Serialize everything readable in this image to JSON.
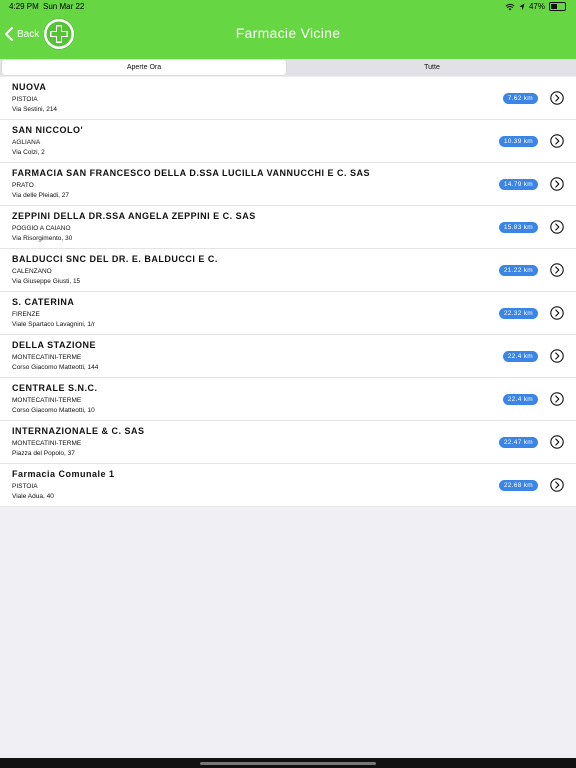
{
  "status_bar": {
    "time": "4:29 PM",
    "date": "Sun Mar 22",
    "battery": "47%",
    "battery_fraction": 0.47
  },
  "header": {
    "back_label": "Back",
    "title": "Farmacie Vicine",
    "logo_icon": "pharmacy-cross-icon",
    "background_color": "#66d643"
  },
  "segments": {
    "open_now": "Aperte Ora",
    "all": "Tutte"
  },
  "pharmacies": [
    {
      "name": "NUOVA",
      "city": "PISTOIA",
      "address": "Via Sestini, 214",
      "distance": "7.62 km"
    },
    {
      "name": "SAN NICCOLO'",
      "city": "AGLIANA",
      "address": "Via Colzi, 2",
      "distance": "10.39 km"
    },
    {
      "name": "FARMACIA SAN FRANCESCO DELLA D.SSA LUCILLA VANNUCCHI E C. SAS",
      "city": "PRATO",
      "address": "Via delle Pleiadi, 27",
      "distance": "14.79 km"
    },
    {
      "name": "ZEPPINI DELLA DR.SSA ANGELA ZEPPINI E C. SAS",
      "city": "POGGIO A CAIANO",
      "address": "Via Risorgimento, 30",
      "distance": "15.83 km"
    },
    {
      "name": "BALDUCCI SNC DEL DR. E. BALDUCCI E C.",
      "city": "CALENZANO",
      "address": "Via Giuseppe Giusti, 15",
      "distance": "21.22 km"
    },
    {
      "name": "S. CATERINA",
      "city": "FIRENZE",
      "address": "Viale Spartaco Lavagnini, 1/r",
      "distance": "22.32 km"
    },
    {
      "name": "DELLA STAZIONE",
      "city": "MONTECATINI-TERME",
      "address": "Corso Giacomo Matteotti, 144",
      "distance": "22.4 km"
    },
    {
      "name": "CENTRALE S.N.C.",
      "city": "MONTECATINI-TERME",
      "address": "Corso Giacomo Matteotti, 10",
      "distance": "22.4 km"
    },
    {
      "name": "INTERNAZIONALE & C. SAS",
      "city": "MONTECATINI-TERME",
      "address": "Piazza del Popolo, 37",
      "distance": "22.47 km"
    },
    {
      "name": "Farmacia Comunale 1",
      "city": "PISTOIA",
      "address": "Viale Adua, 40",
      "distance": "22.68 km"
    }
  ]
}
